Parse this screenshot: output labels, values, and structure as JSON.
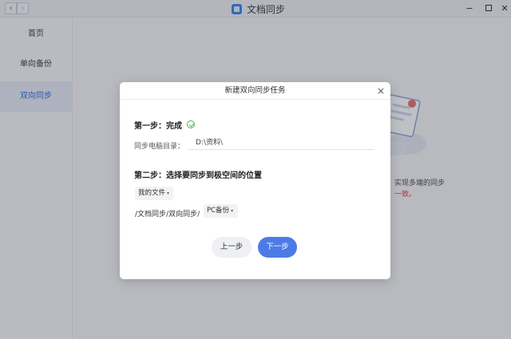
{
  "window": {
    "title": "文档同步",
    "back_icon": "‹",
    "forward_icon": "›",
    "minimize_icon": "−",
    "close_icon": "✕"
  },
  "sidebar": {
    "items": [
      {
        "label": "首页",
        "active": false
      },
      {
        "label": "单向备份",
        "active": false
      },
      {
        "label": "双向同步",
        "active": true
      }
    ]
  },
  "background": {
    "text_line1": "实现多端的同步",
    "text_line2": "一致。"
  },
  "dialog": {
    "title": "新建双向同步任务",
    "close_icon": "×",
    "step1_title": "第一步：完成",
    "dir_label": "同步电脑目录：",
    "dir_value": "D:\\资料\\",
    "step2_title": "第二步：选择要同步到极空间的位置",
    "location_dropdown": "我的文件",
    "path_prefix": "/文档同步/双向同步/",
    "folder_dropdown": "PC备份",
    "prev_button": "上一步",
    "next_button": "下一步",
    "caret": "▾"
  },
  "colors": {
    "accent": "#4d7be6",
    "success": "#46b85a",
    "sidebar_active_text": "#2f64d8"
  }
}
